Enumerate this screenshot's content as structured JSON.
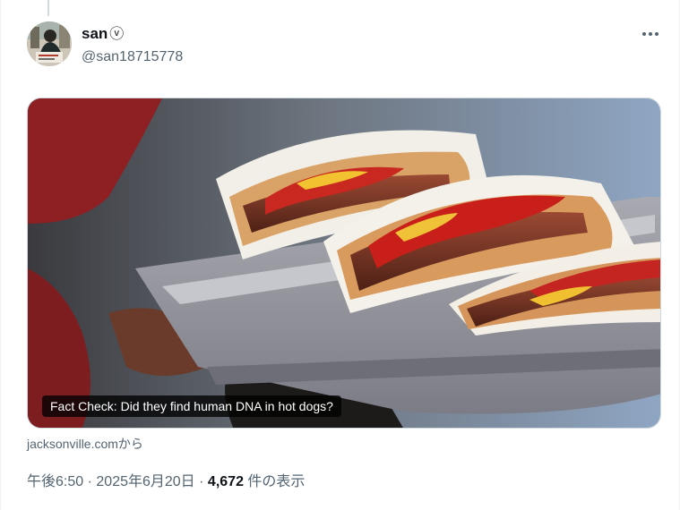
{
  "tweet": {
    "author_name": "san",
    "verified_glyph": "ⓥ",
    "handle": "@san18715778",
    "more_icon": "more-horizontal-icon",
    "link_card": {
      "headline": "Fact Check: Did they find human DNA in hot dogs?",
      "source": "jacksonville.comから"
    },
    "meta": {
      "time": "午後6:50",
      "separator": "·",
      "date": "2025年6月20日",
      "views_count": "4,672",
      "views_label": "件の表示"
    }
  },
  "colors": {
    "text_primary": "#0f1419",
    "text_secondary": "#536471",
    "border": "#cfd9de"
  }
}
